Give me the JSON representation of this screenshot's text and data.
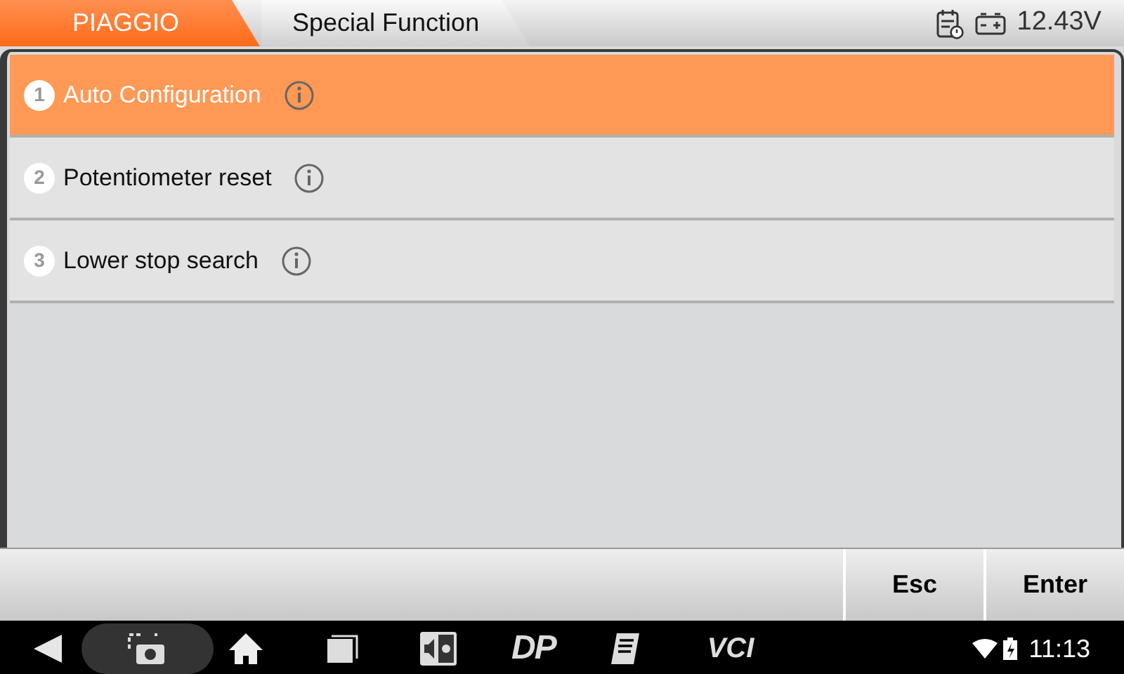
{
  "breadcrumb": [
    {
      "label": "PIAGGIO",
      "selected": true
    },
    {
      "label": "Special Function",
      "selected": false
    }
  ],
  "status": {
    "voltage": "12.43V"
  },
  "functions": [
    {
      "number": "1",
      "label": "Auto Configuration",
      "selected": true
    },
    {
      "number": "2",
      "label": "Potentiometer reset",
      "selected": false
    },
    {
      "number": "3",
      "label": "Lower stop search",
      "selected": false
    }
  ],
  "buttons": [
    "Esc",
    "Enter"
  ],
  "nav_bar": {
    "dp_label": "DP",
    "vci_label": "VCI",
    "time": "11:13"
  }
}
